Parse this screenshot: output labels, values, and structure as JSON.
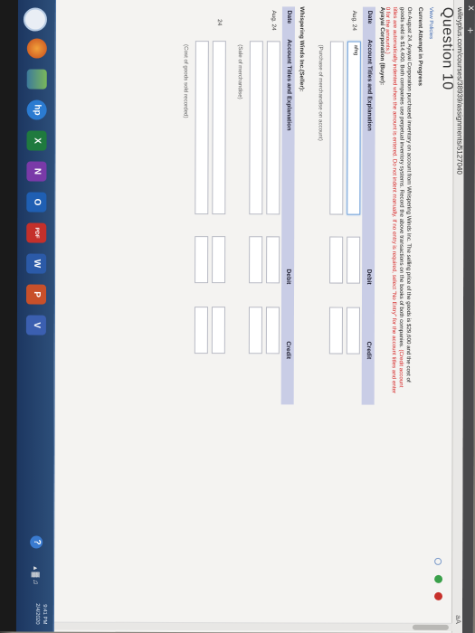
{
  "browser": {
    "tab_close": "x",
    "tab_new": "+",
    "url": "wileyplus.com/courses/38939/assignments/5127040",
    "reader_label": "aA"
  },
  "page": {
    "title": "Question 10",
    "view_policies": "View Policies",
    "attempt_status": "Current Attempt in Progress",
    "problem_part1": "On August 24, Ayayai Corporation purchased inventory on account from Whispering Winds Inc. The selling price of the goods is $29,600 and the cost of goods sold is $14,400. Both companies use perpetual inventory systems. Record the above transactions on the books of both companies.",
    "problem_part2": "(Credit account titles are automatically indented when the amount is entered. Do not indent manually. If no entry is required, select \"No Entry\" for the account titles and enter 0 for the amounts.)"
  },
  "buyer": {
    "heading": "Ayayai Corporation (Buyer):",
    "headers": {
      "date": "Date",
      "account": "Account Titles and Explanation",
      "debit": "Debit",
      "credit": "Credit"
    },
    "rows": [
      {
        "date": "Aug. 24",
        "account_value": "afng",
        "debit": "",
        "credit": ""
      },
      {
        "date": "",
        "account_value": "",
        "debit": "",
        "credit": ""
      }
    ],
    "note": "(Purchase of merchandise on account)"
  },
  "seller": {
    "heading": "Whispering Winds Inc.(Seller):",
    "headers": {
      "date": "Date",
      "account": "Account Titles and Explanation",
      "debit": "Debit",
      "credit": "Credit"
    },
    "sale_date": "Aug. 24",
    "sale_note": "(Sale of merchandise)",
    "cost_date": "24",
    "cost_note": "(Cost of goods sold recorded)"
  },
  "taskbar": {
    "time": "9:41 PM",
    "date": "2/4/2020",
    "help_label": "?",
    "icons": [
      {
        "name": "start",
        "label": ""
      },
      {
        "name": "firefox",
        "label": ""
      },
      {
        "name": "photos",
        "label": ""
      },
      {
        "name": "hp",
        "label": "hp"
      },
      {
        "name": "excel",
        "label": "X"
      },
      {
        "name": "onenote",
        "label": "N"
      },
      {
        "name": "outlook",
        "label": "O"
      },
      {
        "name": "pdf",
        "label": "PDF"
      },
      {
        "name": "word",
        "label": "W"
      },
      {
        "name": "powerpoint",
        "label": "P"
      },
      {
        "name": "visio",
        "label": "V"
      }
    ]
  },
  "colors": {
    "table_header": "#c9cde6",
    "focus_border": "#6f9fd8",
    "taskbar": "#1c3660",
    "instruction_red": "#d62a2a",
    "link": "#3a66b0"
  }
}
